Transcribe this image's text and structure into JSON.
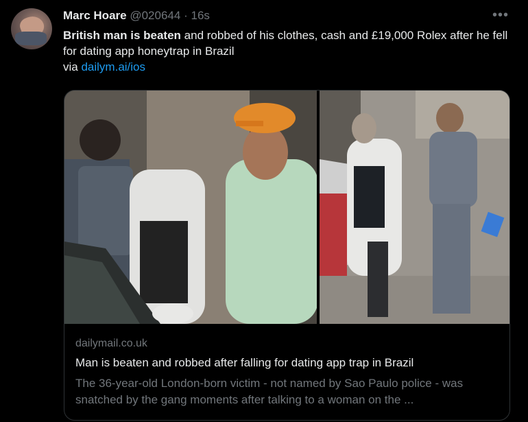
{
  "tweet": {
    "name": "Marc Hoare",
    "handle": "@020644",
    "separator": "·",
    "time": "16s",
    "more_icon": "more-horizontal-icon",
    "text_bold": "British man is beaten",
    "text_rest": " and robbed of his clothes, cash and £19,000 Rolex after he fell for dating app honeytrap in Brazil",
    "via_label": "via ",
    "via_link": "dailym.ai/ios"
  },
  "card": {
    "source": "dailymail.co.uk",
    "title": "Man is beaten and robbed after falling for dating app trap in Brazil",
    "description": "The 36-year-old London-born victim - not named by Sao Paulo police - was snatched by the gang moments after talking to a woman on the ..."
  },
  "colors": {
    "background": "#000000",
    "text": "#e7e9ea",
    "muted": "#71767b",
    "link": "#1d9bf0",
    "border": "#2f3336"
  }
}
